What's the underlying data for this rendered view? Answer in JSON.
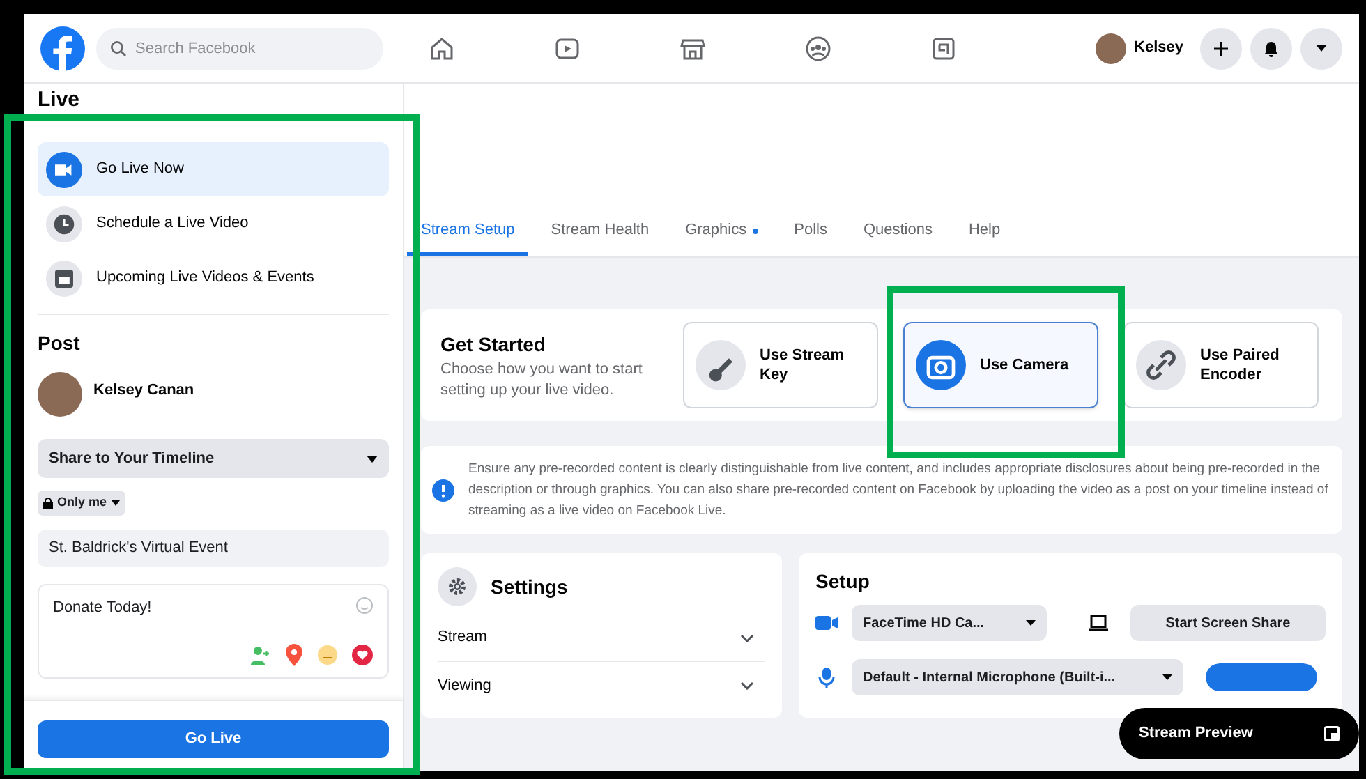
{
  "nav": {
    "search_placeholder": "Search Facebook",
    "profile_name": "Kelsey"
  },
  "sidebar": {
    "title": "Live",
    "items": [
      {
        "label": "Go Live Now",
        "selected": true
      },
      {
        "label": "Schedule a Live Video",
        "selected": false
      },
      {
        "label": "Upcoming Live Videos & Events",
        "selected": false
      }
    ],
    "post_heading": "Post",
    "author": "Kelsey Canan",
    "audience": "Share to Your Timeline",
    "privacy": "Only me",
    "title_field": "St. Baldrick's Virtual Event",
    "description": "Donate Today!",
    "go_live_button": "Go Live"
  },
  "tabs": [
    {
      "label": "Stream Setup",
      "selected": true,
      "dot": false
    },
    {
      "label": "Stream Health",
      "selected": false,
      "dot": false
    },
    {
      "label": "Graphics",
      "selected": false,
      "dot": true
    },
    {
      "label": "Polls",
      "selected": false,
      "dot": false
    },
    {
      "label": "Questions",
      "selected": false,
      "dot": false
    },
    {
      "label": "Help",
      "selected": false,
      "dot": false
    }
  ],
  "get_started": {
    "title": "Get Started",
    "description": "Choose how you want to start setting up your live video.",
    "options": [
      {
        "kind": "key",
        "label": "Use Stream Key",
        "selected": false
      },
      {
        "kind": "camera",
        "label": "Use Camera",
        "selected": true
      },
      {
        "kind": "link",
        "label": "Use Paired Encoder",
        "selected": false
      }
    ]
  },
  "notice": "Ensure any pre-recorded content is clearly distinguishable from live content, and includes appropriate disclosures about being pre-recorded in the description or through graphics. You can also share pre-recorded content on Facebook by uploading the video as a post on your timeline instead of streaming as a live video on Facebook Live.",
  "settings": {
    "title": "Settings",
    "sections": [
      {
        "label": "Stream",
        "expanded": false
      },
      {
        "label": "Viewing",
        "expanded": false
      }
    ]
  },
  "setup": {
    "title": "Setup",
    "camera": "FaceTime HD Ca...",
    "screen_share": "Start Screen Share",
    "microphone": {
      "label": "Default - Internal Microphone (Built-i...",
      "level": 1
    }
  },
  "preview": {
    "label": "Stream Preview"
  }
}
